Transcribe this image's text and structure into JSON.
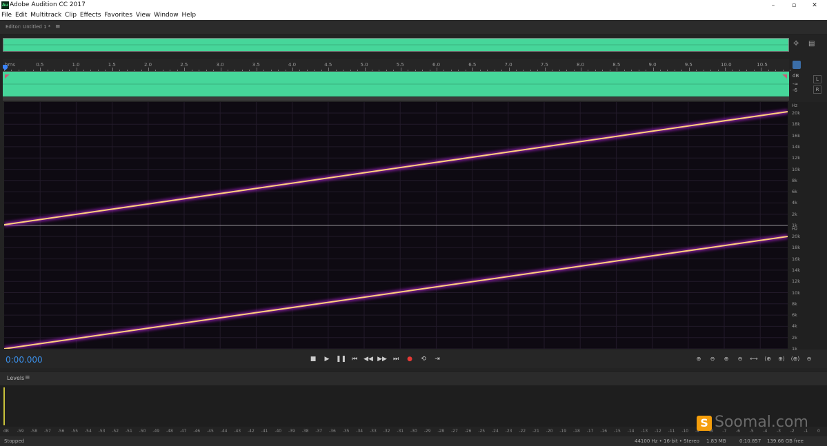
{
  "window": {
    "title": "Adobe Audition CC 2017",
    "icon_label": "Au",
    "minimize": "–",
    "maximize": "▫",
    "close": "✕"
  },
  "menu": [
    "File",
    "Edit",
    "Multitrack",
    "Clip",
    "Effects",
    "Favorites",
    "View",
    "Window",
    "Help"
  ],
  "editor": {
    "tab_label": "Editor: Untitled 1 *",
    "tab_menu_icon": "hamburger-icon"
  },
  "ruler": {
    "unit_label": "hms",
    "ticks": [
      "0.5",
      "1.0",
      "1.5",
      "2.0",
      "2.5",
      "3.0",
      "3.5",
      "4.0",
      "4.5",
      "5.0",
      "5.5",
      "6.0",
      "6.5",
      "7.0",
      "7.5",
      "8.0",
      "8.5",
      "9.0",
      "9.5",
      "10.0",
      "10.5"
    ]
  },
  "amplitude_scale": {
    "unit": "dB",
    "labels": [
      "-∞",
      "-6"
    ],
    "channel_left": "L",
    "channel_right": "R"
  },
  "spectral": {
    "channels": [
      {
        "unit": "Hz",
        "labels": [
          "20k",
          "18k",
          "16k",
          "14k",
          "12k",
          "10k",
          "8k",
          "6k",
          "4k",
          "2k",
          "1k"
        ]
      },
      {
        "unit": "Hz",
        "labels": [
          "20k",
          "18k",
          "16k",
          "14k",
          "12k",
          "10k",
          "8k",
          "6k",
          "4k",
          "2k",
          "1k"
        ]
      }
    ],
    "colors": {
      "sweep": "#ffd27a",
      "glow": "#a020c0",
      "background": "#0e0a12",
      "waveform": "#46d69a"
    }
  },
  "transport": {
    "timecode": "0:00.000",
    "buttons": [
      {
        "name": "stop-button",
        "glyph": "■"
      },
      {
        "name": "play-button",
        "glyph": "▶"
      },
      {
        "name": "pause-button",
        "glyph": "❚❚"
      },
      {
        "name": "go-to-start-button",
        "glyph": "⏮"
      },
      {
        "name": "rewind-button",
        "glyph": "◀◀"
      },
      {
        "name": "fast-forward-button",
        "glyph": "▶▶"
      },
      {
        "name": "go-to-end-button",
        "glyph": "⏭"
      },
      {
        "name": "record-button",
        "glyph": "●"
      },
      {
        "name": "loop-playback-button",
        "glyph": "⟲"
      },
      {
        "name": "skip-selection-button",
        "glyph": "⇥"
      }
    ],
    "zoom_buttons": [
      {
        "name": "zoom-in-amplitude-button",
        "glyph": "⊕"
      },
      {
        "name": "zoom-out-amplitude-button",
        "glyph": "⊖"
      },
      {
        "name": "zoom-in-time-button",
        "glyph": "⊕"
      },
      {
        "name": "zoom-out-time-button",
        "glyph": "⊖"
      },
      {
        "name": "zoom-full-button",
        "glyph": "⟷"
      },
      {
        "name": "zoom-in-at-in-point-button",
        "glyph": "⟨⊕"
      },
      {
        "name": "zoom-in-at-out-point-button",
        "glyph": "⊕⟩"
      },
      {
        "name": "zoom-selection-button",
        "glyph": "⟨⊕⟩"
      },
      {
        "name": "zoom-out-full-button",
        "glyph": "⊖"
      }
    ]
  },
  "levels": {
    "label": "Levels",
    "menu_icon": "hamburger-icon",
    "scale": [
      "dB",
      "-59",
      "-58",
      "-57",
      "-56",
      "-55",
      "-54",
      "-53",
      "-52",
      "-51",
      "-50",
      "-49",
      "-48",
      "-47",
      "-46",
      "-45",
      "-44",
      "-43",
      "-42",
      "-41",
      "-40",
      "-39",
      "-38",
      "-37",
      "-36",
      "-35",
      "-34",
      "-33",
      "-32",
      "-31",
      "-30",
      "-29",
      "-28",
      "-27",
      "-26",
      "-25",
      "-24",
      "-23",
      "-22",
      "-21",
      "-20",
      "-19",
      "-18",
      "-17",
      "-16",
      "-15",
      "-14",
      "-13",
      "-12",
      "-11",
      "-10",
      "-9",
      "-8",
      "-7",
      "-6",
      "-5",
      "-4",
      "-3",
      "-2",
      "-1",
      "0"
    ]
  },
  "watermark": {
    "badge": "S",
    "text": "Soomal.com"
  },
  "status": {
    "state": "Stopped",
    "format": "44100 Hz • 16-bit • Stereo",
    "size": "1.83 MB",
    "duration": "0:10.857",
    "free": "139.66 GB free"
  }
}
